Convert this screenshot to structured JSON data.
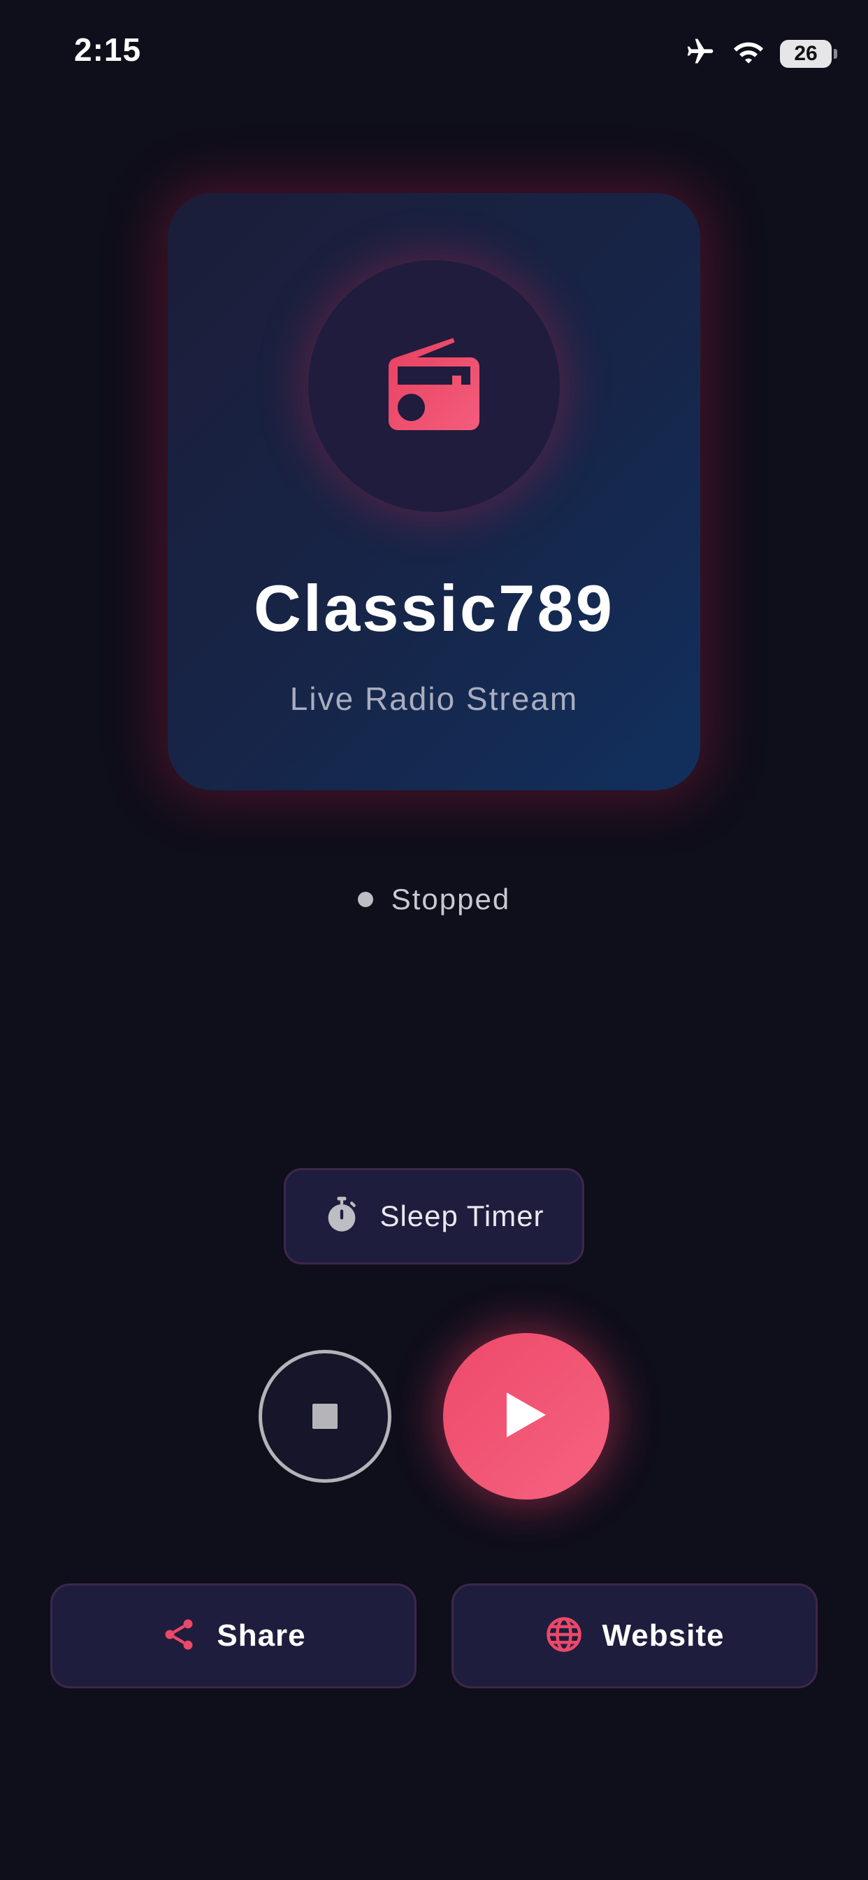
{
  "status_bar": {
    "time": "2:15",
    "battery_level": "26",
    "icons": [
      "airplane-icon",
      "wifi-icon",
      "battery-icon"
    ]
  },
  "station": {
    "name": "Classic789",
    "subtitle": "Live Radio Stream",
    "icon": "radio-icon"
  },
  "player": {
    "status": "Stopped",
    "sleep_timer_label": "Sleep Timer",
    "stop_icon": "stop-icon",
    "play_icon": "play-icon"
  },
  "actions": {
    "share_label": "Share",
    "website_label": "Website"
  },
  "colors": {
    "background": "#0f0e1b",
    "accent": "#f0506f",
    "card_start": "#1b1d38",
    "card_end": "#11305e",
    "button_bg": "#1e1d3d"
  }
}
